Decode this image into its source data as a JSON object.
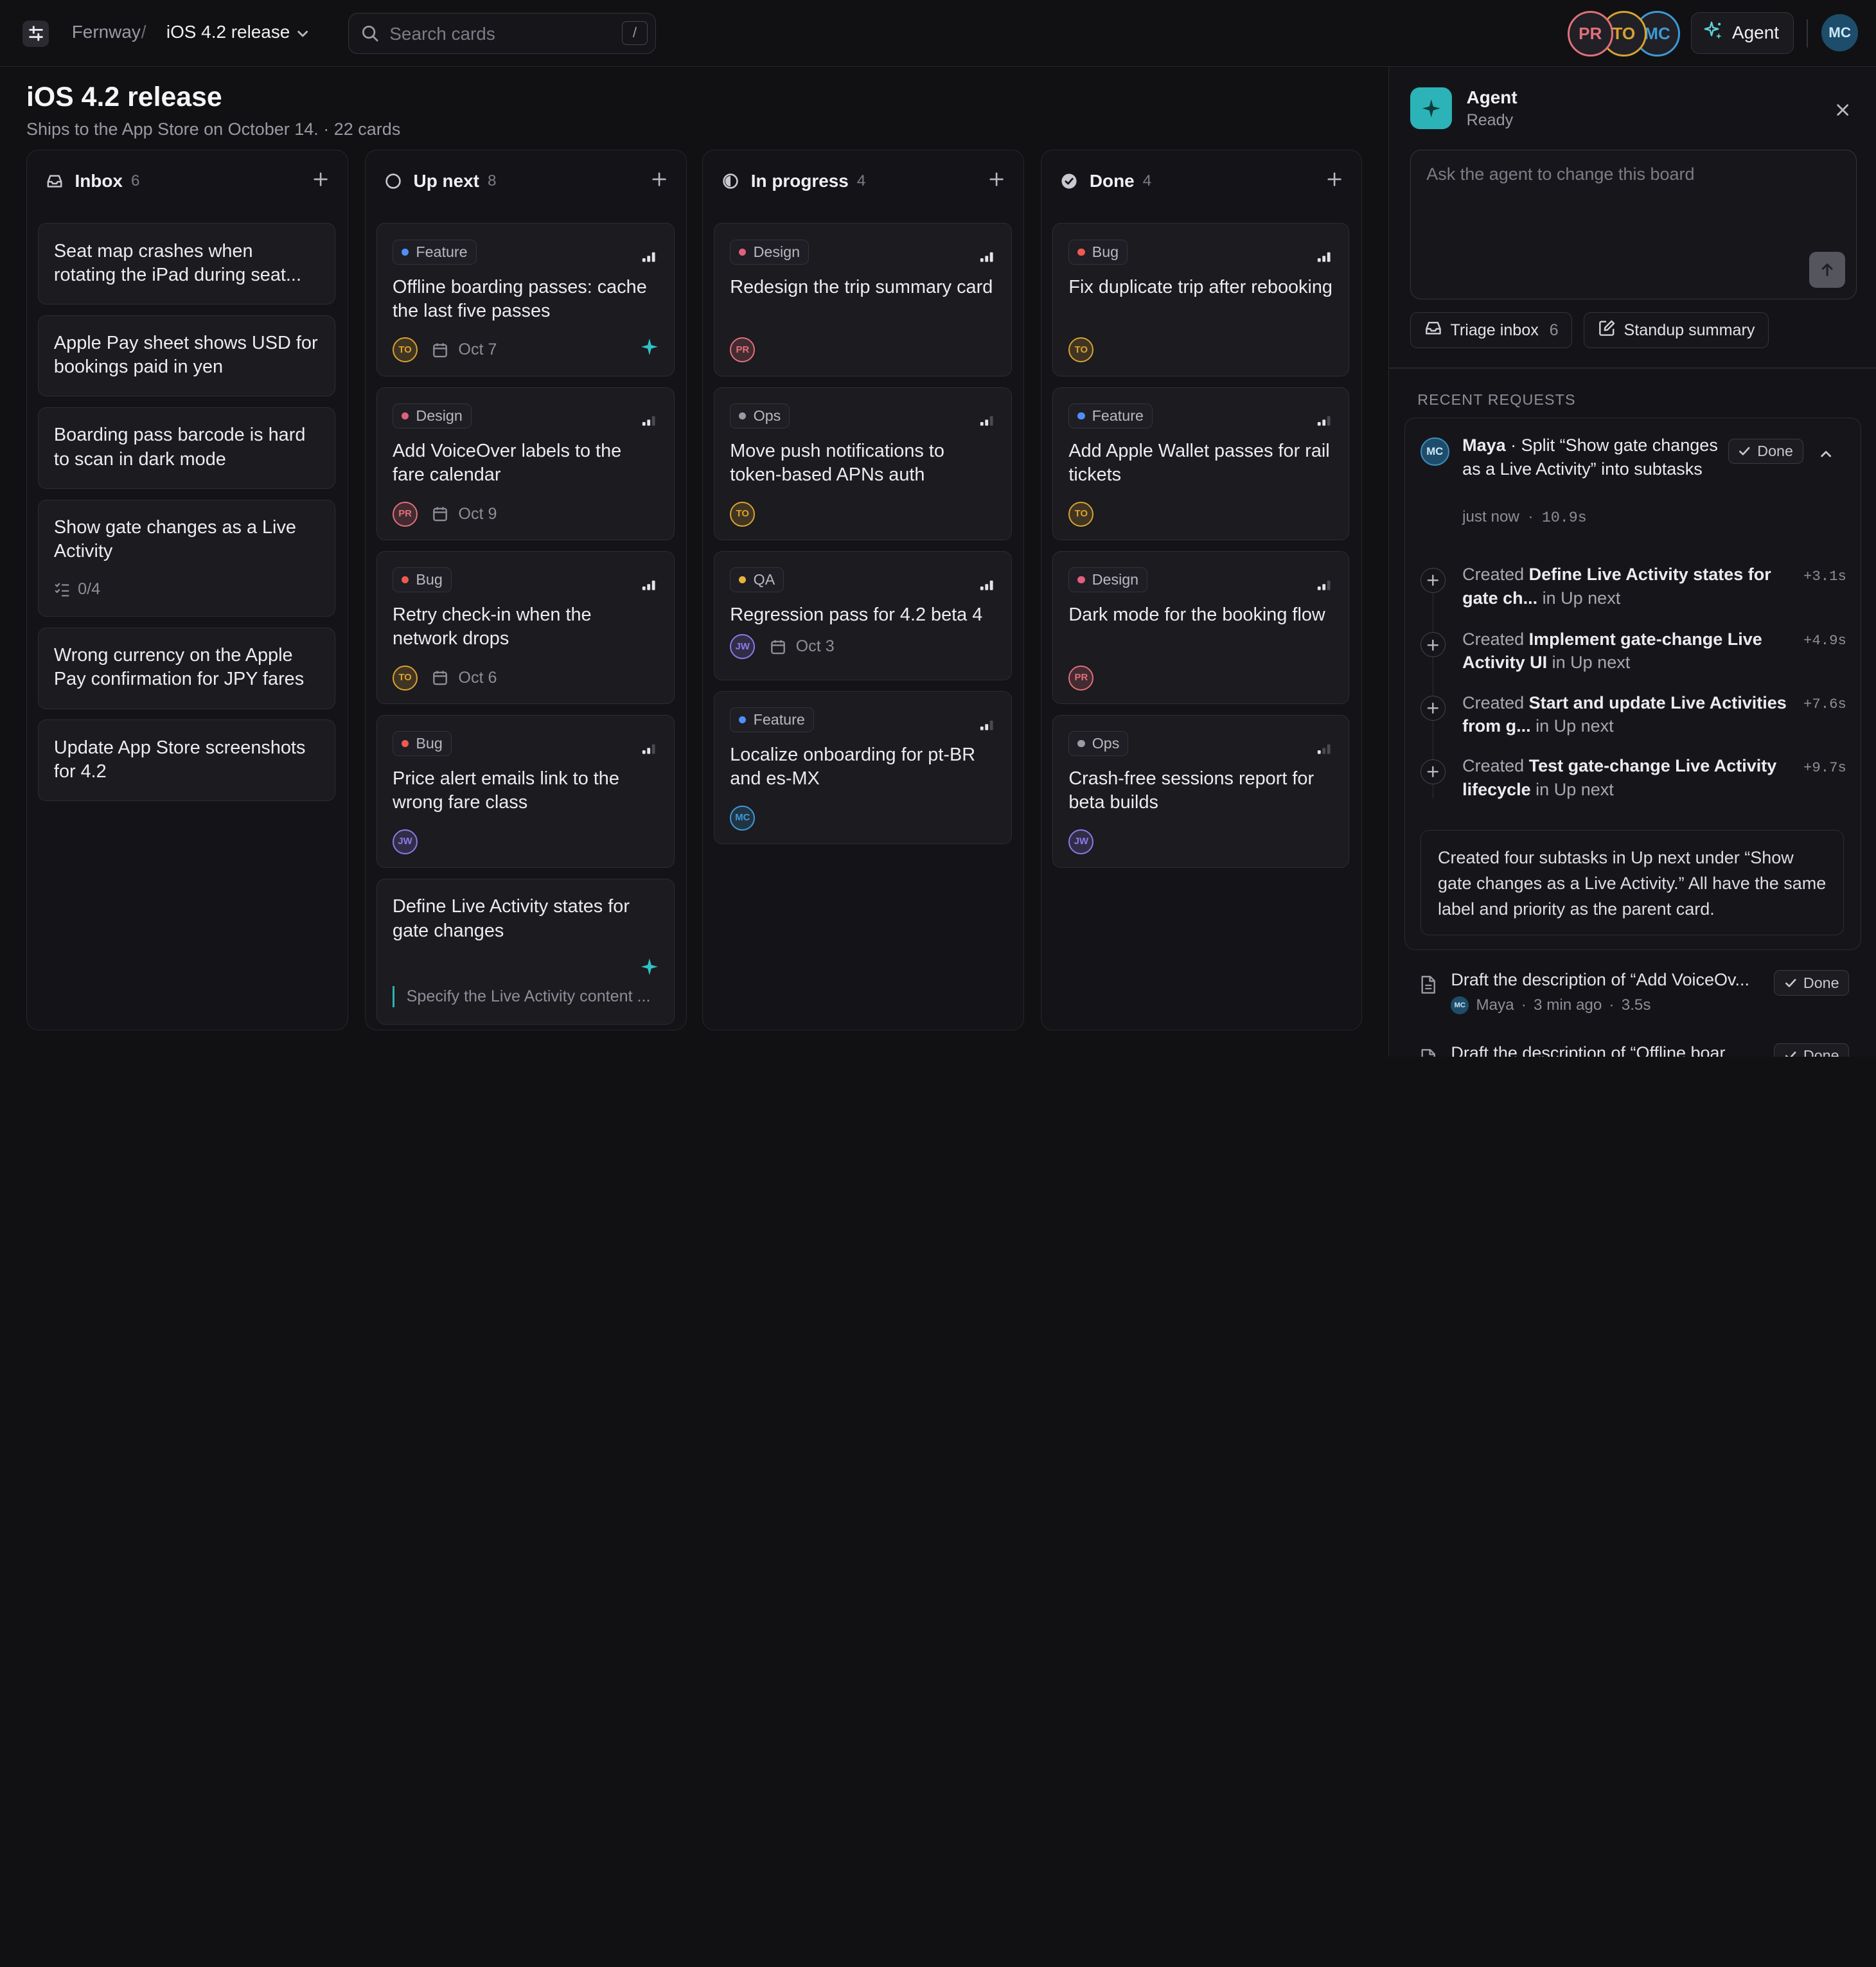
{
  "topbar": {
    "workspace": "Fernway",
    "separator": "/",
    "board": "iOS 4.2 release",
    "search_placeholder": "Search cards",
    "search_shortcut": "/",
    "avatars": [
      {
        "initials": "PR",
        "color": "#e0707a"
      },
      {
        "initials": "TO",
        "color": "#d9a230"
      },
      {
        "initials": "MC",
        "color": "#3c9ad6"
      }
    ],
    "agent_label": "Agent",
    "me_initials": "MC"
  },
  "board": {
    "title": "iOS 4.2 release",
    "subtitle": "Ships to the App Store on October 14. · 22 cards"
  },
  "columns": [
    {
      "title": "Inbox",
      "count": "6",
      "icon": "inbox-icon",
      "cards": [
        {
          "title": "Seat map crashes when rotating the iPad during seat..."
        },
        {
          "title": "Apple Pay sheet shows USD for bookings paid in yen"
        },
        {
          "title": "Boarding pass barcode is hard to scan in dark mode"
        },
        {
          "title": "Show gate changes as a Live Activity",
          "subtasks": "0/4"
        },
        {
          "title": "Wrong currency on the Apple Pay confirmation for JPY fares"
        },
        {
          "title": "Update App Store screenshots for 4.2"
        }
      ]
    },
    {
      "title": "Up next",
      "count": "8",
      "icon": "circle-icon",
      "cards": [
        {
          "label": "Feature",
          "title": "Offline boarding passes: cache the last five passes",
          "assignee": "TO",
          "due": "Oct 7",
          "priority": 3
        },
        {
          "label": "Design",
          "title": "Add VoiceOver labels to the fare calendar",
          "assignee": "PR",
          "due": "Oct 9",
          "priority": 2
        },
        {
          "label": "Bug",
          "title": "Retry check-in when the network drops",
          "assignee": "TO",
          "due": "Oct 6",
          "priority": 3
        },
        {
          "label": "Bug",
          "title": "Price alert emails link to the wrong fare class",
          "assignee": "JW",
          "priority": 2
        },
        {
          "title": "Define Live Activity states for gate changes",
          "note": "Specify the Live Activity content ..."
        }
      ]
    },
    {
      "title": "In progress",
      "count": "4",
      "icon": "half-circle-icon",
      "cards": [
        {
          "label": "Design",
          "title": "Redesign the trip summary card",
          "assignee": "PR",
          "priority": 3
        },
        {
          "label": "Ops",
          "title": "Move push notifications to token-based APNs auth",
          "assignee": "TO",
          "priority": 2
        },
        {
          "label": "QA",
          "title": "Regression pass for 4.2 beta 4",
          "assignee": "JW",
          "due": "Oct 3",
          "priority": 3
        },
        {
          "label": "Feature",
          "title": "Localize onboarding for pt-BR and es-MX",
          "assignee": "MC",
          "priority": 2
        }
      ]
    },
    {
      "title": "Done",
      "count": "4",
      "icon": "check-circle-icon",
      "cards": [
        {
          "label": "Bug",
          "title": "Fix duplicate trip after rebooking",
          "assignee": "TO",
          "priority": 3
        },
        {
          "label": "Feature",
          "title": "Add Apple Wallet passes for rail tickets",
          "assignee": "TO",
          "priority": 2
        },
        {
          "label": "Design",
          "title": "Dark mode for the booking flow",
          "assignee": "PR",
          "priority": 2
        },
        {
          "label": "Ops",
          "title": "Crash-free sessions report for beta builds",
          "assignee": "JW",
          "priority": 1
        }
      ]
    }
  ],
  "label_colors": {
    "Feature": "#4f8ff7",
    "Design": "#e0607e",
    "Bug": "#ef5a4f",
    "Ops": "#9a9aa4",
    "QA": "#e6b43a"
  },
  "assignee_colors": {
    "TO": "#d9a230",
    "PR": "#e0707a",
    "JW": "#8c7ae6",
    "MC": "#3c9ad6"
  },
  "panel": {
    "title": "Agent",
    "status": "Ready",
    "prompt_placeholder": "Ask the agent to change this board",
    "quick_actions": [
      {
        "label": "Triage inbox",
        "count": "6"
      },
      {
        "label": "Standup summary"
      }
    ],
    "recent_heading": "RECENT REQUESTS",
    "request": {
      "avatar": "MC",
      "author": "Maya",
      "text": " · Split “Show gate changes as a Live Activity” into subtasks",
      "time": "just now",
      "duration": "10.9s",
      "status": "Done",
      "steps": [
        {
          "verb": "Created ",
          "item": "Define Live Activity states for gate ch...",
          "where": " in Up next",
          "delta": "+3.1s"
        },
        {
          "verb": "Created ",
          "item": "Implement gate-change Live Activity UI",
          "where": " in Up next",
          "delta": "+4.9s"
        },
        {
          "verb": "Created ",
          "item": "Start and update Live Activities from g...",
          "where": " in Up next",
          "delta": "+7.6s"
        },
        {
          "verb": "Created ",
          "item": "Test gate-change Live Activity lifecycle",
          "where": " in Up next",
          "delta": "+9.7s"
        }
      ],
      "summary": "Created four subtasks in Up next under “Show gate changes as a Live Activity.” All have the same label and priority as the parent card."
    },
    "previous": [
      {
        "title": "Draft the description of “Add VoiceOv...",
        "author": "Maya",
        "avatar": "MC",
        "time": "3 min ago",
        "duration": "3.5s",
        "status": "Done"
      },
      {
        "title": "Draft the description of “Offline boar...",
        "status": "Done"
      }
    ]
  }
}
